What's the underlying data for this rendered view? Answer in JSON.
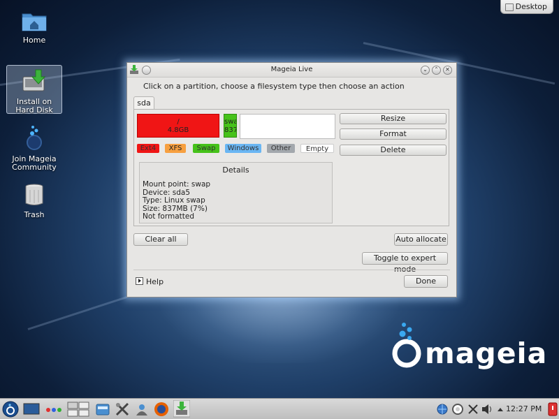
{
  "desktop_button": {
    "label": "Desktop"
  },
  "desktop_icons": [
    {
      "name": "Home"
    },
    {
      "name": "Install on Hard Disk"
    },
    {
      "name": "Join Mageia Community"
    },
    {
      "name": "Trash"
    }
  ],
  "dialog": {
    "title": "Mageia Live",
    "instruction": "Click on a partition, choose a filesystem type then choose an action",
    "tab": "sda",
    "partitions": {
      "root": {
        "mount": "/",
        "size": "4.8GB",
        "color": "#f01515"
      },
      "swap": {
        "label": "swa",
        "size": "837",
        "color": "#46c21a"
      }
    },
    "legend": {
      "ext4": "Ext4",
      "xfs": "XFS",
      "swap": "Swap",
      "windows": "Windows",
      "other": "Other",
      "empty": "Empty"
    },
    "details": {
      "title": "Details",
      "mount_point": "Mount point: swap",
      "device": "Device: sda5",
      "type": "Type: Linux swap",
      "size": "Size: 837MB (7%)",
      "format": "Not formatted"
    },
    "actions": {
      "resize": "Resize",
      "format": "Format",
      "delete": "Delete"
    },
    "clear_all": "Clear all",
    "auto_allocate": "Auto allocate",
    "toggle_expert": "Toggle to expert mode",
    "help": "Help",
    "done": "Done"
  },
  "logo": {
    "text": "mageia"
  },
  "taskbar": {
    "clock": "12:27 PM"
  }
}
